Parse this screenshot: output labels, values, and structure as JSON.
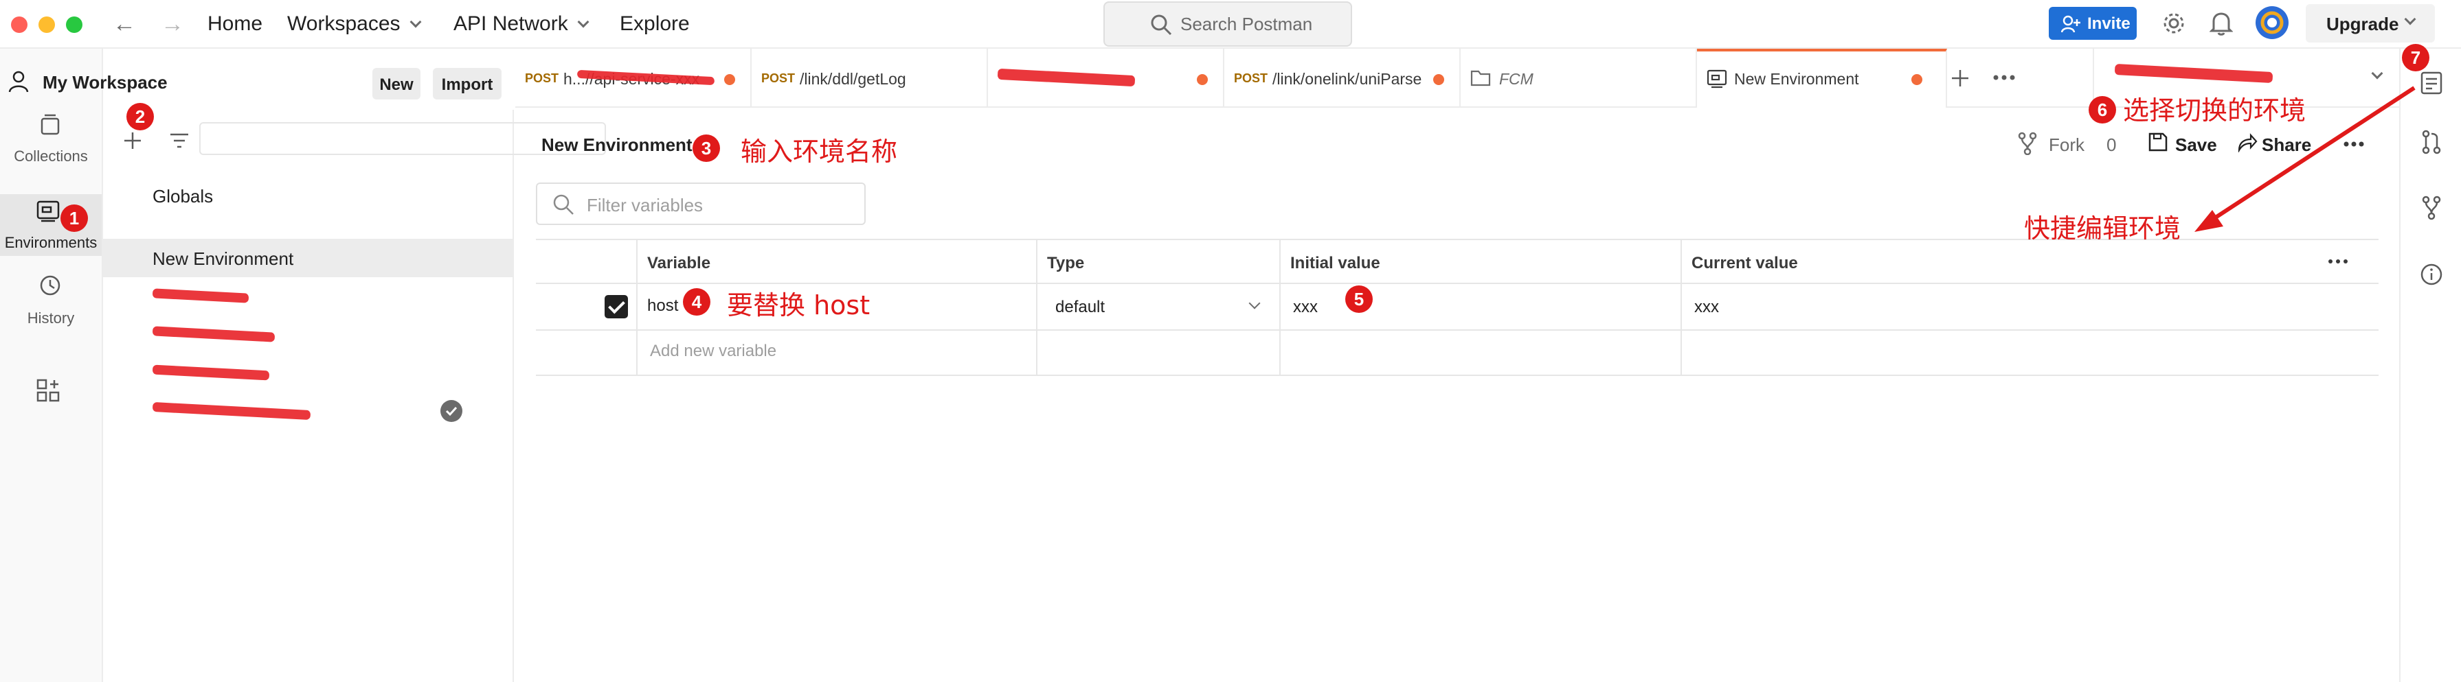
{
  "topbar": {
    "nav": [
      "Home",
      "Workspaces",
      "API Network",
      "Explore"
    ],
    "search_placeholder": "Search Postman",
    "invite_label": "Invite",
    "upgrade_label": "Upgrade"
  },
  "workspace": {
    "title": "My Workspace",
    "new_label": "New",
    "import_label": "Import"
  },
  "rail": {
    "collections": "Collections",
    "environments": "Environments",
    "history": "History"
  },
  "sidebar": {
    "globals": "Globals",
    "environments": [
      "New Environment"
    ]
  },
  "tabs": [
    {
      "method": "POST",
      "path": "h...//api-service-xxx"
    },
    {
      "method": "POST",
      "path": "/link/ddl/getLog"
    },
    {
      "method": "",
      "path": ""
    },
    {
      "method": "POST",
      "path": "/link/onelink/uniParse"
    },
    {
      "method": "",
      "path": "FCM"
    },
    {
      "method": "",
      "path": "New Environment"
    }
  ],
  "editor": {
    "env_name": "New Environment",
    "fork_label": "Fork",
    "fork_count": "0",
    "save_label": "Save",
    "share_label": "Share",
    "filter_placeholder": "Filter variables",
    "columns": [
      "Variable",
      "Type",
      "Initial value",
      "Current value"
    ],
    "rows": [
      {
        "variable": "host",
        "type": "default",
        "initial": "xxx",
        "current": "xxx",
        "enabled": true
      }
    ],
    "add_placeholder": "Add new variable"
  },
  "annotations": {
    "b1": "1",
    "b2": "2",
    "b3": "3",
    "b4": "4",
    "b5": "5",
    "b6": "6",
    "b7": "7",
    "t3": "输入环境名称",
    "t4": "要替换 host",
    "t6": "选择切换的环境",
    "t_quick": "快捷编辑环境"
  },
  "colors": {
    "accent": "#f26b3a",
    "invite": "#1f6fd6",
    "annotation_red": "#e01a1a"
  }
}
